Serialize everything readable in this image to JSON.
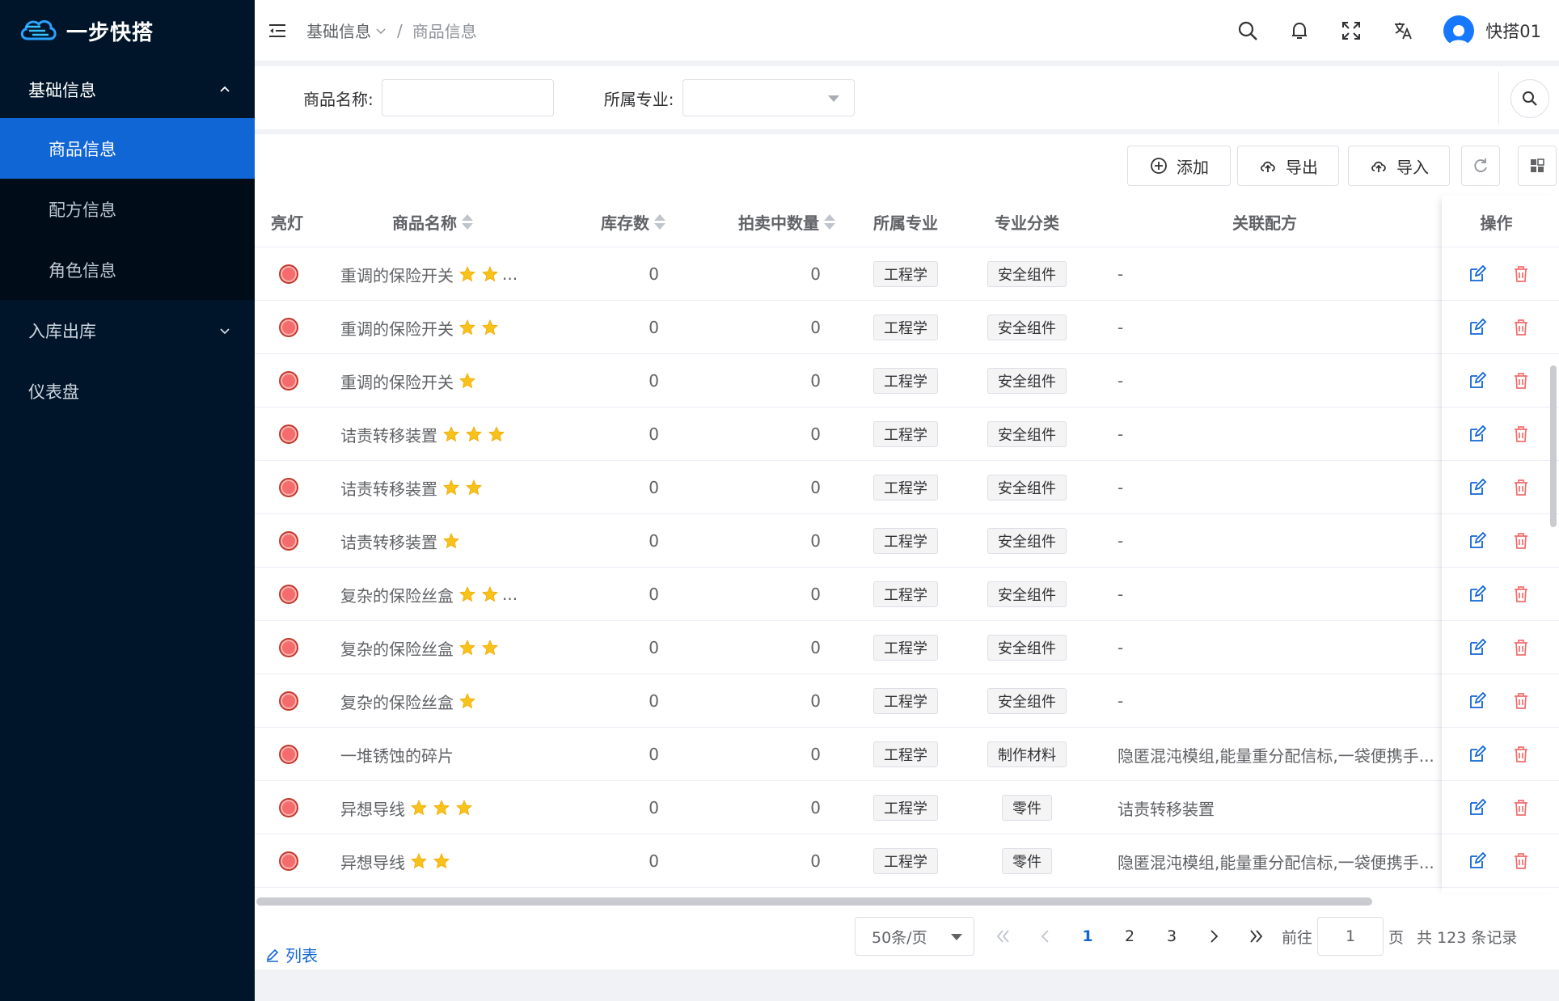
{
  "app": {
    "name": "一步快搭"
  },
  "sidebar": {
    "groups": [
      {
        "label": "基础信息",
        "expanded": true,
        "items": [
          "商品信息",
          "配方信息",
          "角色信息"
        ],
        "active": "商品信息"
      },
      {
        "label": "入库出库",
        "expanded": false
      },
      {
        "label": "仪表盘"
      }
    ]
  },
  "header": {
    "breadcrumb": [
      "基础信息",
      "/",
      "商品信息"
    ],
    "icons": [
      "search-icon",
      "bell-icon",
      "fullscreen-icon",
      "translate-icon"
    ],
    "user": "快搭01"
  },
  "search": {
    "name_label": "商品名称:",
    "name_value": "",
    "major_label": "所属专业:",
    "major_value": ""
  },
  "toolbar": {
    "add": "添加",
    "export": "导出",
    "import": "导入"
  },
  "table": {
    "columns": [
      "亮灯",
      "商品名称",
      "库存数",
      "拍卖中数量",
      "所属专业",
      "专业分类",
      "关联配方",
      "操作"
    ],
    "rows": [
      {
        "name": "重调的保险开关",
        "stars": 2,
        "ellipsis": "...",
        "stock": "0",
        "auction": "0",
        "major": "工程学",
        "category": "安全组件",
        "recipe": "-"
      },
      {
        "name": "重调的保险开关",
        "stars": 2,
        "ellipsis": "",
        "stock": "0",
        "auction": "0",
        "major": "工程学",
        "category": "安全组件",
        "recipe": "-"
      },
      {
        "name": "重调的保险开关",
        "stars": 1,
        "ellipsis": "",
        "stock": "0",
        "auction": "0",
        "major": "工程学",
        "category": "安全组件",
        "recipe": "-"
      },
      {
        "name": "诘责转移装置",
        "stars": 3,
        "ellipsis": "",
        "stock": "0",
        "auction": "0",
        "major": "工程学",
        "category": "安全组件",
        "recipe": "-"
      },
      {
        "name": "诘责转移装置",
        "stars": 2,
        "ellipsis": "",
        "stock": "0",
        "auction": "0",
        "major": "工程学",
        "category": "安全组件",
        "recipe": "-"
      },
      {
        "name": "诘责转移装置",
        "stars": 1,
        "ellipsis": "",
        "stock": "0",
        "auction": "0",
        "major": "工程学",
        "category": "安全组件",
        "recipe": "-"
      },
      {
        "name": "复杂的保险丝盒",
        "stars": 2,
        "ellipsis": "...",
        "stock": "0",
        "auction": "0",
        "major": "工程学",
        "category": "安全组件",
        "recipe": "-"
      },
      {
        "name": "复杂的保险丝盒",
        "stars": 2,
        "ellipsis": "",
        "stock": "0",
        "auction": "0",
        "major": "工程学",
        "category": "安全组件",
        "recipe": "-"
      },
      {
        "name": "复杂的保险丝盒",
        "stars": 1,
        "ellipsis": "",
        "stock": "0",
        "auction": "0",
        "major": "工程学",
        "category": "安全组件",
        "recipe": "-"
      },
      {
        "name": "一堆锈蚀的碎片",
        "stars": 0,
        "ellipsis": "",
        "stock": "0",
        "auction": "0",
        "major": "工程学",
        "category": "制作材料",
        "recipe": "隐匿混沌模组,能量重分配信标,一袋便携手..."
      },
      {
        "name": "异想导线",
        "stars": 3,
        "ellipsis": "",
        "stock": "0",
        "auction": "0",
        "major": "工程学",
        "category": "零件",
        "recipe": "诘责转移装置"
      },
      {
        "name": "异想导线",
        "stars": 2,
        "ellipsis": "",
        "stock": "0",
        "auction": "0",
        "major": "工程学",
        "category": "零件",
        "recipe": "隐匿混沌模组,能量重分配信标,一袋便携手..."
      }
    ]
  },
  "footer": {
    "list_link": "列表"
  },
  "pagination": {
    "page_size": "50条/页",
    "pages": [
      "1",
      "2",
      "3"
    ],
    "current": "1",
    "goto_label": "前往",
    "goto_value": "1",
    "page_unit": "页",
    "total": "共 123 条记录"
  },
  "colors": {
    "sidebar_bg": "#001529",
    "active": "#1166d6",
    "danger": "#f56c6c",
    "star": "#f7c21b"
  }
}
